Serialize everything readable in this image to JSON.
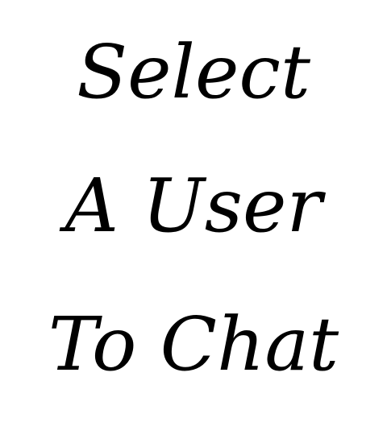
{
  "empty_state": {
    "lines": [
      "Select",
      "A User",
      "To Chat"
    ],
    "text_color": "#000000",
    "background_color": "#ffffff"
  }
}
